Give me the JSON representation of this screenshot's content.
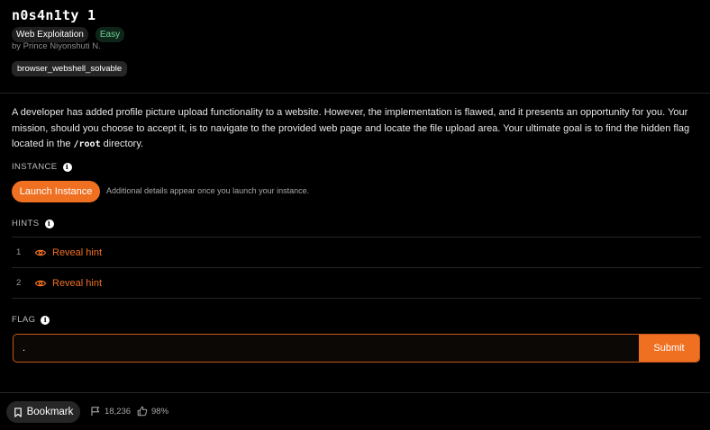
{
  "challenge": {
    "title": "n0s4n1ty 1",
    "category": "Web Exploitation",
    "difficulty": "Easy",
    "author": "by Prince Niyonshuti N.",
    "tag": "browser_webshell_solvable",
    "description_before_code": "A developer has added profile picture upload functionality to a website. However, the implementation is flawed, and it presents an opportunity for you. Your mission, should you choose to accept it, is to navigate to the provided web page and locate the file upload area. Your ultimate goal is to find the hidden flag located in the ",
    "description_code": "/root",
    "description_after_code": " directory."
  },
  "instance": {
    "label": "INSTANCE",
    "button": "Launch Instance",
    "note": "Additional details appear once you launch your instance."
  },
  "hints": {
    "label": "HINTS",
    "items": [
      {
        "num": "1",
        "label": "Reveal hint"
      },
      {
        "num": "2",
        "label": "Reveal hint"
      }
    ]
  },
  "flag": {
    "label": "FLAG",
    "value": ".",
    "submit": "Submit"
  },
  "footer": {
    "bookmark": "Bookmark",
    "solves": "18,236",
    "likes": "98%"
  },
  "colors": {
    "accent": "#f07022",
    "background": "#000000",
    "easy": "#6fd39a"
  }
}
